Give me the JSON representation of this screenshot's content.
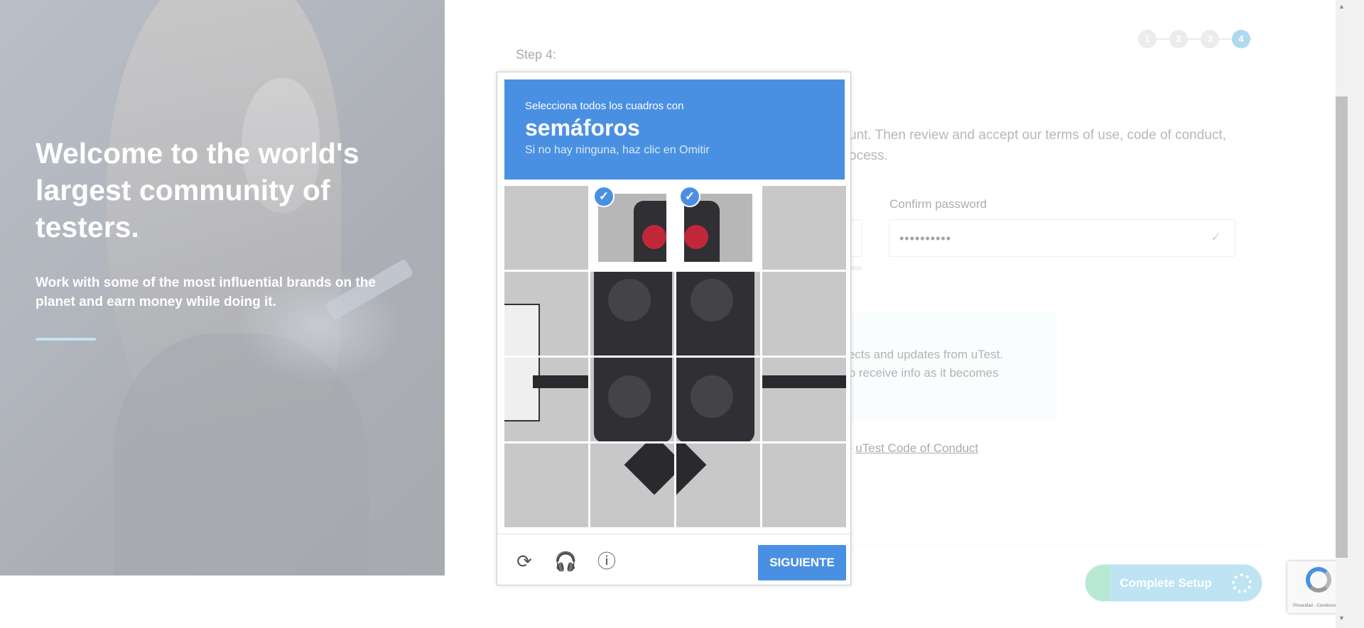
{
  "hero": {
    "headline": "Welcome to the world's largest community of testers.",
    "subtext": "Work with some of the most influential brands on the planet and earn money while doing it."
  },
  "form": {
    "step_label": "Step 4:",
    "steps": [
      "1",
      "2",
      "3",
      "4"
    ],
    "active_step": 4,
    "intro_line1": "unt. Then review and accept our terms of use, code of conduct,",
    "intro_line2": "ocess.",
    "confirm_password_label": "Confirm password",
    "confirm_password_value": "••••••••••",
    "info_line1": "jects and updates from uTest.",
    "info_line2": "to receive info as it becomes",
    "conduct_prefix": "e",
    "conduct_link": "uTest Code of Conduct",
    "complete_button": "Complete Setup"
  },
  "captcha": {
    "instruction": "Selecciona todos los cuadros con",
    "target": "semáforos",
    "hint": "Si no hay ninguna, haz clic en Omitir",
    "next_button": "SIGUIENTE",
    "selected_tiles": [
      1,
      2
    ],
    "footer_icons": [
      "reload-icon",
      "audio-icon",
      "info-icon"
    ]
  },
  "recaptcha_badge": {
    "text": "Privacidad - Condiciones"
  },
  "colors": {
    "captcha_blue": "#4a90e2",
    "step_active": "#5cb3de",
    "accent_line": "#7fc9e6",
    "check_green": "#6ccf84"
  }
}
